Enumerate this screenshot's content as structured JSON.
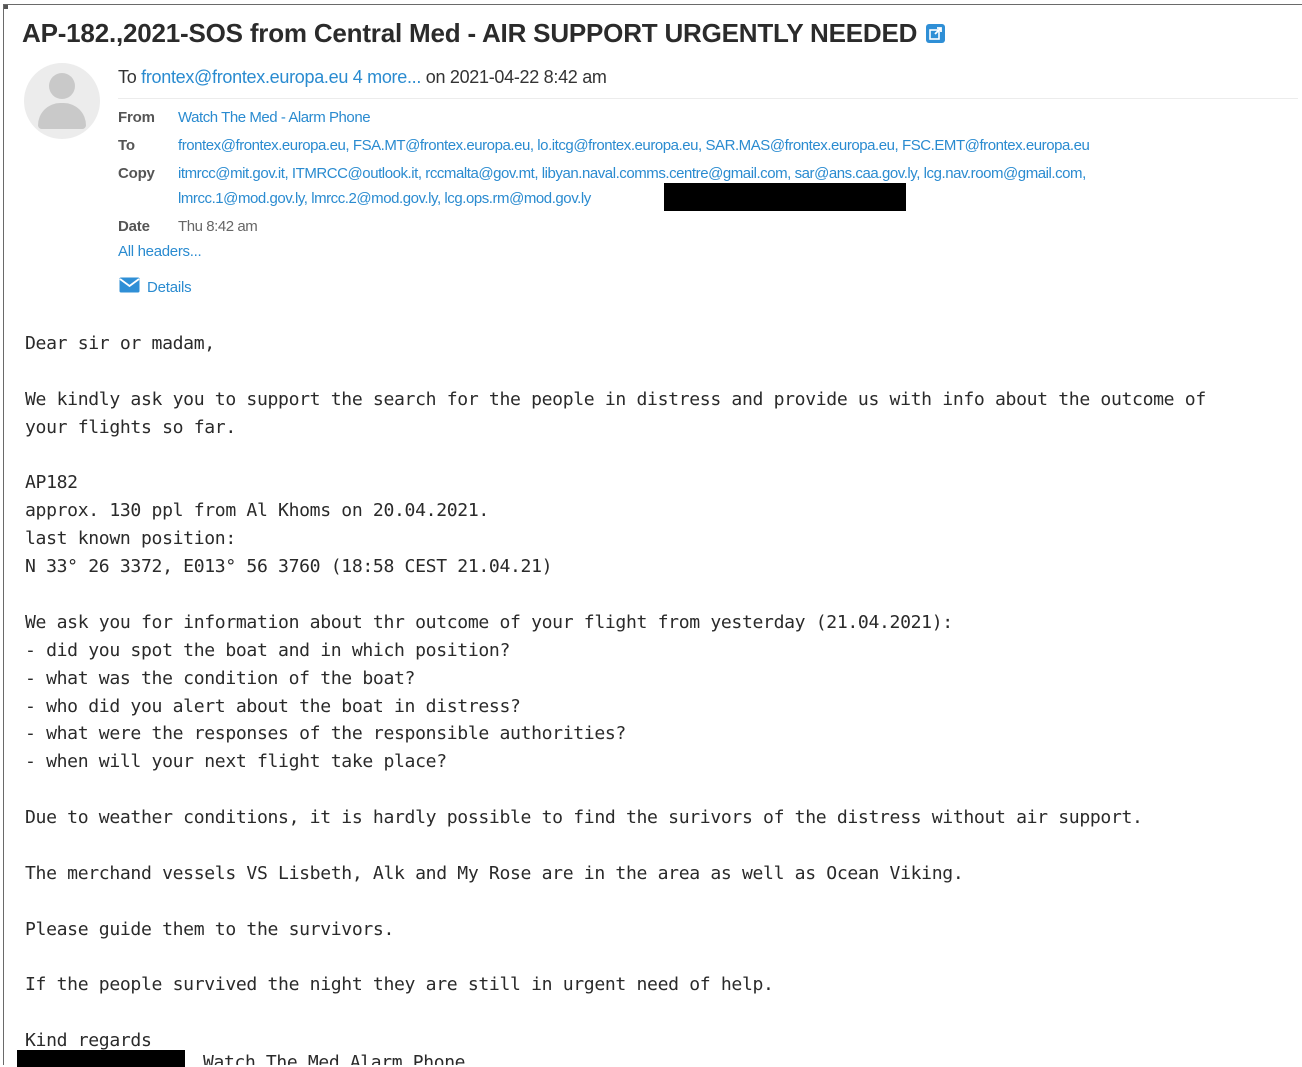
{
  "email": {
    "subject": "AP-182.,2021-SOS from Central Med - AIR SUPPORT URGENTLY NEEDED",
    "summary": {
      "to_prefix": "To",
      "to_link": "frontex@frontex.europa.eu",
      "more_link": "4 more...",
      "date_text": "on 2021-04-22 8:42 am"
    },
    "headers": {
      "from_label": "From",
      "from_value": "Watch The Med - Alarm Phone",
      "to_label": "To",
      "to_value": "frontex@frontex.europa.eu, FSA.MT@frontex.europa.eu, lo.itcg@frontex.europa.eu, SAR.MAS@frontex.europa.eu, FSC.EMT@frontex.europa.eu",
      "copy_label": "Copy",
      "copy_line1": "itmrcc@mit.gov.it, ITMRCC@outlook.it, rccmalta@gov.mt, libyan.naval.comms.centre@gmail.com, sar@ans.caa.gov.ly, lcg.nav.room@gmail.com,",
      "copy_line2": "lmrcc.1@mod.gov.ly, lmrcc.2@mod.gov.ly, lcg.ops.rm@mod.gov.ly",
      "date_label": "Date",
      "date_value": "Thu 8:42 am"
    },
    "all_headers_link": "All headers...",
    "details_link": "Details",
    "body": [
      "Dear sir or madam,",
      "",
      "We kindly ask you to support the search for the people in distress and provide us with info about the outcome of",
      "your flights so far.",
      "",
      "AP182",
      "approx. 130 ppl from Al Khoms on 20.04.2021.",
      "last known position:",
      "N 33° 26 3372, E013° 56 3760 (18:58 CEST 21.04.21)",
      "",
      "We ask you for information about thr outcome of your flight from yesterday (21.04.2021):",
      "- did you spot the boat and in which position?",
      "- what was the condition of the boat?",
      "- who did you alert about the boat in distress?",
      "- what were the responses of the responsible authorities?",
      "- when will your next flight take place?",
      "",
      "Due to weather conditions, it is hardly possible to find the surivors of the distress without air support.",
      "",
      "The merchand vessels VS Lisbeth, Alk and My Rose are in the area as well as Ocean Viking.",
      "",
      "Please guide them to the survivors.",
      "",
      "If the people survived the night they are still in urgent need of help.",
      "",
      "Kind regards"
    ],
    "signature_text": "Watch The Med Alarm Phone"
  },
  "colors": {
    "link": "#2a8bd0",
    "icon_blue": "#2f8fd6",
    "redaction": "#000000"
  },
  "icons": {
    "subject_icon": "external-link-icon",
    "details_icon": "envelope-icon",
    "avatar_icon": "person-icon"
  }
}
